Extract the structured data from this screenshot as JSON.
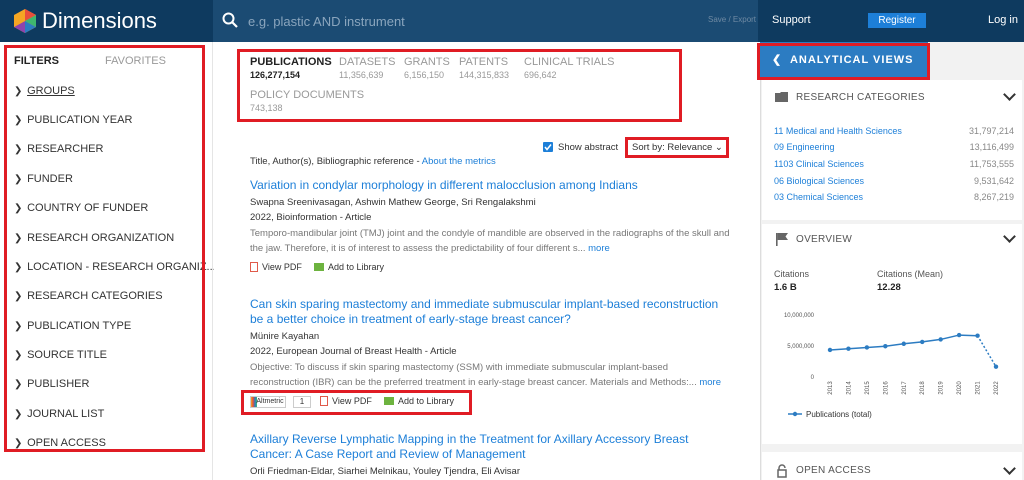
{
  "header": {
    "brand": "Dimensions",
    "search_placeholder": "e.g. plastic AND instrument",
    "save_export": "Save / Export",
    "support": "Support",
    "register": "Register",
    "login": "Log in",
    "colors": {
      "bar": "#0e3a5f",
      "accent": "#1d7fd8"
    }
  },
  "filters": {
    "tab_filters": "FILTERS",
    "tab_favorites": "FAVORITES",
    "items": [
      "GROUPS",
      "PUBLICATION YEAR",
      "RESEARCHER",
      "FUNDER",
      "COUNTRY OF FUNDER",
      "RESEARCH ORGANIZATION",
      "LOCATION - RESEARCH ORGANIZ...",
      "RESEARCH CATEGORIES",
      "PUBLICATION TYPE",
      "SOURCE TITLE",
      "PUBLISHER",
      "JOURNAL LIST",
      "OPEN ACCESS"
    ]
  },
  "tabs": [
    {
      "label": "PUBLICATIONS",
      "count": "126,277,154"
    },
    {
      "label": "DATASETS",
      "count": "11,356,639"
    },
    {
      "label": "GRANTS",
      "count": "6,156,150"
    },
    {
      "label": "PATENTS",
      "count": "144,315,833"
    },
    {
      "label": "CLINICAL TRIALS",
      "count": "696,642"
    },
    {
      "label": "POLICY DOCUMENTS",
      "count": "743,138"
    }
  ],
  "controls": {
    "show_abstract": "Show abstract",
    "sort_by": "Sort by: Relevance",
    "bib_ref": "Title, Author(s), Bibliographic reference -",
    "about_metrics": "About the metrics"
  },
  "results": [
    {
      "title": "Variation in condylar morphology in different malocclusion among Indians",
      "authors": "Swapna Sreenivasagan, Ashwin Mathew George, Sri Rengalakshmi",
      "meta": "2022, Bioinformation - Article",
      "abstract": "Temporo-mandibular joint (TMJ) joint and the condyle of mandible are observed in the radiographs of the skull and the jaw. Therefore, it is of interest to assess the predictability of four different s...",
      "more": "more",
      "view_pdf": "View PDF",
      "add_library": "Add to Library"
    },
    {
      "title": "Can skin sparing mastectomy and immediate submuscular implant-based reconstruction be a better choice in treatment of early-stage breast cancer?",
      "authors": "Münire Kayahan",
      "meta": "2022, European Journal of Breast Health - Article",
      "abstract": "Objective: To discuss if skin sparing mastectomy (SSM) with immediate submuscular implant-based reconstruction (IBR) can be the preferred treatment in early-stage breast cancer. Materials and Methods:...",
      "more": "more",
      "altmetric": "Altmetric",
      "altmetric_score": "1",
      "view_pdf": "View PDF",
      "add_library": "Add to Library"
    },
    {
      "title": "Axillary Reverse Lymphatic Mapping in the Treatment for Axillary Accessory Breast Cancer: A Case Report and Review of Management",
      "authors": "Orli Friedman-Eldar, Siarhei Melnikau, Youley Tjendra, Eli Avisar"
    }
  ],
  "analytical": {
    "header": "ANALYTICAL VIEWS",
    "research_categories_title": "RESEARCH CATEGORIES",
    "categories": [
      {
        "name": "11 Medical and Health Sciences",
        "value": "31,797,214"
      },
      {
        "name": "09 Engineering",
        "value": "13,116,499"
      },
      {
        "name": "1103 Clinical Sciences",
        "value": "11,753,555"
      },
      {
        "name": "06 Biological Sciences",
        "value": "9,531,642"
      },
      {
        "name": "03 Chemical Sciences",
        "value": "8,267,219"
      }
    ],
    "overview_title": "OVERVIEW",
    "citations_label": "Citations",
    "citations_value": "1.6 B",
    "citations_mean_label": "Citations (Mean)",
    "citations_mean_value": "12.28",
    "open_access_title": "OPEN ACCESS"
  },
  "chart_data": {
    "type": "line",
    "x": [
      "2013",
      "2014",
      "2015",
      "2016",
      "2017",
      "2018",
      "2019",
      "2020",
      "2021",
      "2022"
    ],
    "series": [
      {
        "name": "Publications (total)",
        "values": [
          4200000,
          4400000,
          4600000,
          4800000,
          5200000,
          5500000,
          5900000,
          6600000,
          6500000,
          1500000
        ]
      }
    ],
    "y_ticks": [
      "10,000,000",
      "5,000,000",
      "0"
    ],
    "ylim": [
      0,
      10000000
    ],
    "grid": false,
    "legend": "bottom",
    "color": "#2c7cc2"
  }
}
